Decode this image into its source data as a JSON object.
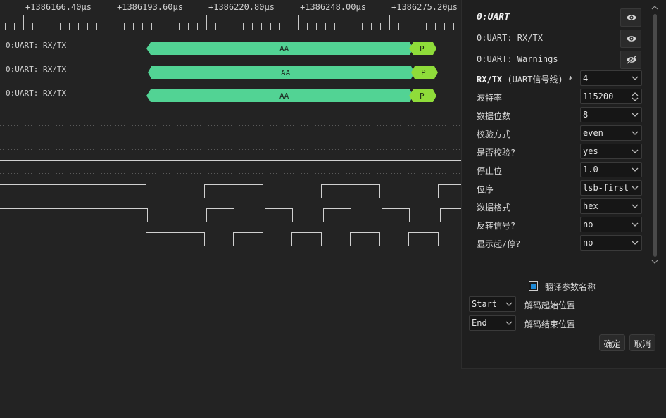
{
  "ruler": {
    "labels": [
      "+1386166.40µs",
      "+1386193.60µs",
      "+1386220.80µs",
      "+1386248.00µs",
      "+1386275.20µs"
    ]
  },
  "channels": [
    {
      "label": "0:UART: RX/TX",
      "data_text": "AA",
      "parity_text": "P"
    },
    {
      "label": "0:UART: RX/TX",
      "data_text": "AA",
      "parity_text": "P"
    },
    {
      "label": "0:UART: RX/TX",
      "data_text": "AA",
      "parity_text": "P"
    }
  ],
  "panel": {
    "title": "0:UART",
    "rows_eye": [
      {
        "label": "0:UART: RX/TX",
        "visible": true
      },
      {
        "label": "0:UART: Warnings",
        "visible": false
      }
    ],
    "rx_tx": {
      "label_bold": "RX/TX",
      "label_rest": " (UART信号线) *",
      "value": "4"
    },
    "params": [
      {
        "label": "波特率",
        "value": "115200",
        "type": "spin"
      },
      {
        "label": "数据位数",
        "value": "8",
        "type": "select"
      },
      {
        "label": "校验方式",
        "value": "even",
        "type": "select"
      },
      {
        "label": "是否校验?",
        "value": "yes",
        "type": "select"
      },
      {
        "label": "停止位",
        "value": "1.0",
        "type": "select"
      },
      {
        "label": "位序",
        "value": "lsb-first",
        "type": "select"
      },
      {
        "label": "数据格式",
        "value": "hex",
        "type": "select"
      },
      {
        "label": "反转信号?",
        "value": "no",
        "type": "select"
      },
      {
        "label": "显示起/停?",
        "value": "no",
        "type": "select"
      }
    ],
    "translate_label": "翻译参数名称",
    "translate_checked": true,
    "start_select": "Start",
    "start_label": "解码起始位置",
    "end_select": "End",
    "end_label": "解码结束位置",
    "ok_button": "确定",
    "cancel_button": "取消"
  },
  "colors": {
    "decode_fill": "#52d394",
    "parity_fill": "#8fdc3a",
    "checkbox": "#1e8ad6"
  }
}
